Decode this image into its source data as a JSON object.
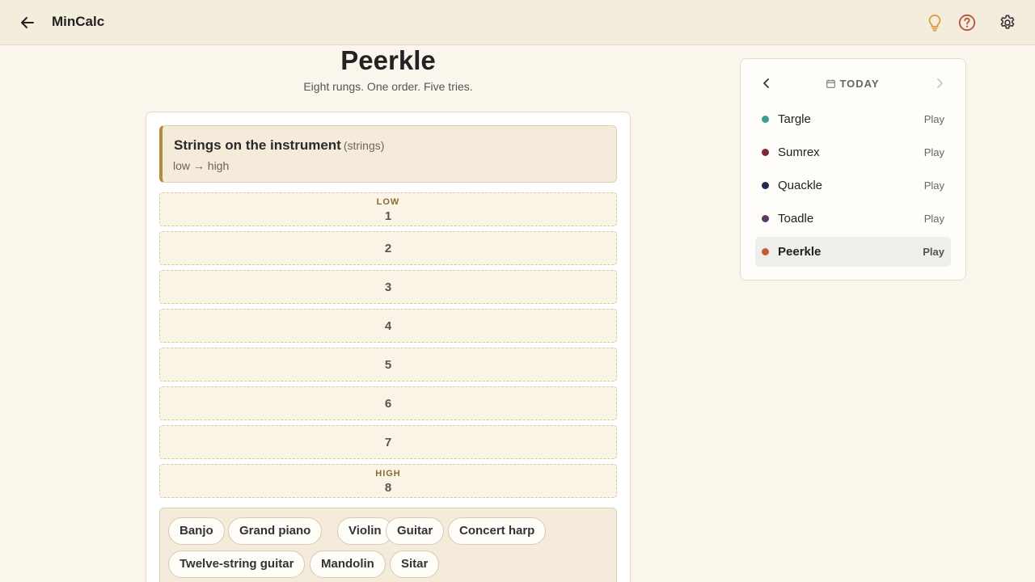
{
  "header": {
    "app_title": "MinCalc",
    "back_icon": "arrow-left-icon",
    "hint_icon": "lightbulb-icon",
    "help_icon": "question-circle-icon",
    "settings_icon": "gear-icon",
    "accent_color": "#d89b3a",
    "help_color": "#b5533a"
  },
  "game": {
    "title": "Peerkle",
    "subtitle": "Eight rungs. One order. Five tries."
  },
  "prompt": {
    "title": "Strings on the instrument",
    "unit": "(strings)",
    "order": "low → high"
  },
  "rungs": {
    "low_caption": "LOW",
    "high_caption": "HIGH",
    "slots": [
      "1",
      "2",
      "3",
      "4",
      "5",
      "6",
      "7",
      "8"
    ]
  },
  "bank": {
    "options": [
      "Banjo",
      "Grand piano",
      "Violin",
      "Guitar",
      "Concert harp",
      "Twelve-string guitar",
      "Mandolin",
      "Sitar"
    ]
  },
  "sidebar": {
    "date_label": "TODAY",
    "prev_icon": "chevron-left-icon",
    "next_icon": "chevron-right-icon",
    "games": [
      {
        "name": "Targle",
        "action": "Play",
        "color": "#3f9e8f"
      },
      {
        "name": "Sumrex",
        "action": "Play",
        "color": "#7a2a35"
      },
      {
        "name": "Quackle",
        "action": "Play",
        "color": "#23284f"
      },
      {
        "name": "Toadle",
        "action": "Play",
        "color": "#5a3a6a"
      },
      {
        "name": "Peerkle",
        "action": "Play",
        "color": "#c0603a",
        "active": true
      }
    ]
  }
}
